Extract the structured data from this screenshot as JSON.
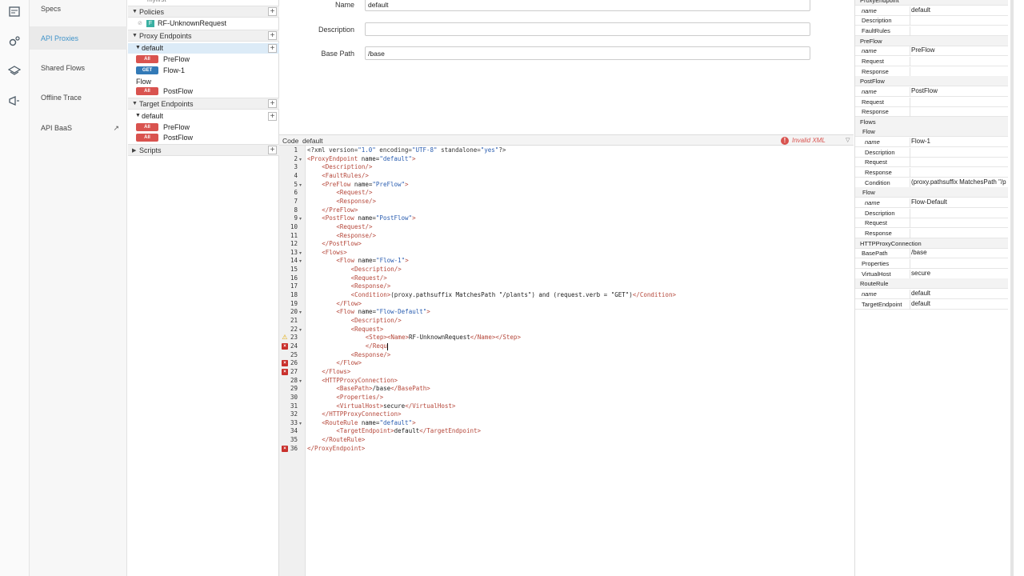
{
  "nav": {
    "items": [
      {
        "label": "Specs"
      },
      {
        "label": "API Proxies"
      },
      {
        "label": "Shared Flows"
      },
      {
        "label": "Offline Trace"
      },
      {
        "label": "API BaaS"
      }
    ]
  },
  "tree": {
    "top_cut": "myfirst",
    "policies_label": "Policies",
    "policy_item": "RF-UnknownRequest",
    "proxy_endpoints_label": "Proxy Endpoints",
    "pe_default": "default",
    "all_badge": "All",
    "get_badge": "GET",
    "preflow": "PreFlow",
    "flow1": "Flow-1",
    "flow_label": "Flow",
    "postflow": "PostFlow",
    "target_endpoints_label": "Target Endpoints",
    "te_default": "default",
    "scripts_label": "Scripts"
  },
  "form": {
    "name_label": "Name",
    "name_value": "default",
    "description_label": "Description",
    "description_value": "",
    "basepath_label": "Base Path",
    "basepath_value": "/base"
  },
  "code_header": {
    "code_label": "Code",
    "file_label": "default",
    "error_text": "Invalid XML",
    "error_icon": "!"
  },
  "code": {
    "lines": [
      "1",
      "2",
      "3",
      "4",
      "5",
      "6",
      "7",
      "8",
      "9",
      "10",
      "11",
      "12",
      "13",
      "14",
      "15",
      "16",
      "17",
      "18",
      "19",
      "20",
      "21",
      "22",
      "23",
      "24",
      "25",
      "26",
      "27",
      "28",
      "29",
      "30",
      "31",
      "32",
      "33",
      "34",
      "35",
      "36"
    ],
    "t": {
      "l1a": "<?xml version=",
      "l1b": "\"1.0\"",
      "l1c": " encoding=",
      "l1d": "\"UTF-8\"",
      "l1e": " standalone=",
      "l1f": "\"yes\"",
      "l1g": "?>",
      "l2a": "<ProxyEndpoint",
      "l2b": " name=",
      "l2c": "\"default\"",
      "l2d": ">",
      "l3": "<Description/>",
      "l4": "<FaultRules/>",
      "l5a": "<PreFlow",
      "l5b": " name=",
      "l5c": "\"PreFlow\"",
      "l5d": ">",
      "l6": "<Request/>",
      "l7": "<Response/>",
      "l8": "</PreFlow>",
      "l9a": "<PostFlow",
      "l9b": " name=",
      "l9c": "\"PostFlow\"",
      "l9d": ">",
      "l10": "<Request/>",
      "l11": "<Response/>",
      "l12": "</PostFlow>",
      "l13": "<Flows>",
      "l14a": "<Flow",
      "l14b": " name=",
      "l14c": "\"Flow-1\"",
      "l14d": ">",
      "l15": "<Description/>",
      "l16": "<Request/>",
      "l17": "<Response/>",
      "l18a": "<Condition>",
      "l18b": "(proxy.pathsuffix MatchesPath \"/plants\") and (request.verb = \"GET\")",
      "l18c": "</Condition>",
      "l19": "</Flow>",
      "l20a": "<Flow",
      "l20b": " name=",
      "l20c": "\"Flow-Default\"",
      "l20d": ">",
      "l21": "<Description/>",
      "l22": "<Request>",
      "l23a": "<Step><Name>",
      "l23b": "RF-UnknownRequest",
      "l23c": "</Name></Step>",
      "l24": "</Requ",
      "l25": "<Response/>",
      "l26": "</Flow>",
      "l27": "</Flows>",
      "l28": "<HTTPProxyConnection>",
      "l29a": "<BasePath>",
      "l29b": "/base",
      "l29c": "</BasePath>",
      "l30": "<Properties/>",
      "l31a": "<VirtualHost>",
      "l31b": "secure",
      "l31c": "</VirtualHost>",
      "l32": "</HTTPProxyConnection>",
      "l33a": "<RouteRule",
      "l33b": " name=",
      "l33c": "\"default\"",
      "l33d": ">",
      "l34a": "<TargetEndpoint>",
      "l34b": "default",
      "l34c": "</TargetEndpoint>",
      "l35": "</RouteRule>",
      "l36": "</ProxyEndpoint>"
    }
  },
  "props": {
    "rows": [
      {
        "k": "ProxyEndpoint",
        "v": ""
      },
      {
        "k": "name",
        "v": "default"
      },
      {
        "k": "Description",
        "v": ""
      },
      {
        "k": "FaultRules",
        "v": ""
      },
      {
        "k": "PreFlow",
        "v": ""
      },
      {
        "k": "name",
        "v": "PreFlow"
      },
      {
        "k": "Request",
        "v": ""
      },
      {
        "k": "Response",
        "v": ""
      },
      {
        "k": "PostFlow",
        "v": ""
      },
      {
        "k": "name",
        "v": "PostFlow"
      },
      {
        "k": "Request",
        "v": ""
      },
      {
        "k": "Response",
        "v": ""
      },
      {
        "k": "Flows",
        "v": ""
      },
      {
        "k": "Flow",
        "v": ""
      },
      {
        "k": "name",
        "v": "Flow-1"
      },
      {
        "k": "Description",
        "v": ""
      },
      {
        "k": "Request",
        "v": ""
      },
      {
        "k": "Response",
        "v": ""
      },
      {
        "k": "Condition",
        "v": "(proxy.pathsuffix MatchesPath \"/p"
      },
      {
        "k": "Flow",
        "v": ""
      },
      {
        "k": "name",
        "v": "Flow-Default"
      },
      {
        "k": "Description",
        "v": ""
      },
      {
        "k": "Request",
        "v": ""
      },
      {
        "k": "Response",
        "v": ""
      },
      {
        "k": "HTTPProxyConnection",
        "v": ""
      },
      {
        "k": "BasePath",
        "v": "/base"
      },
      {
        "k": "Properties",
        "v": ""
      },
      {
        "k": "VirtualHost",
        "v": "secure"
      },
      {
        "k": "RouteRule",
        "v": ""
      },
      {
        "k": "name",
        "v": "default"
      },
      {
        "k": "TargetEndpoint",
        "v": "default"
      }
    ]
  },
  "icons": {
    "specs": "specs-icon",
    "proxies": "gear-icon",
    "shared": "layers-icon",
    "trace": "megaphone-icon",
    "baas_arrow": "external-link-icon",
    "error": "error-icon",
    "warning": "warning-icon",
    "collapse": "collapse-icon"
  },
  "colors": {
    "accent": "#3f93c9",
    "error": "#d9534f",
    "get": "#337ab7",
    "highlight": "#fbf7c8",
    "tag": "#b5473a",
    "value": "#2a5db0"
  }
}
